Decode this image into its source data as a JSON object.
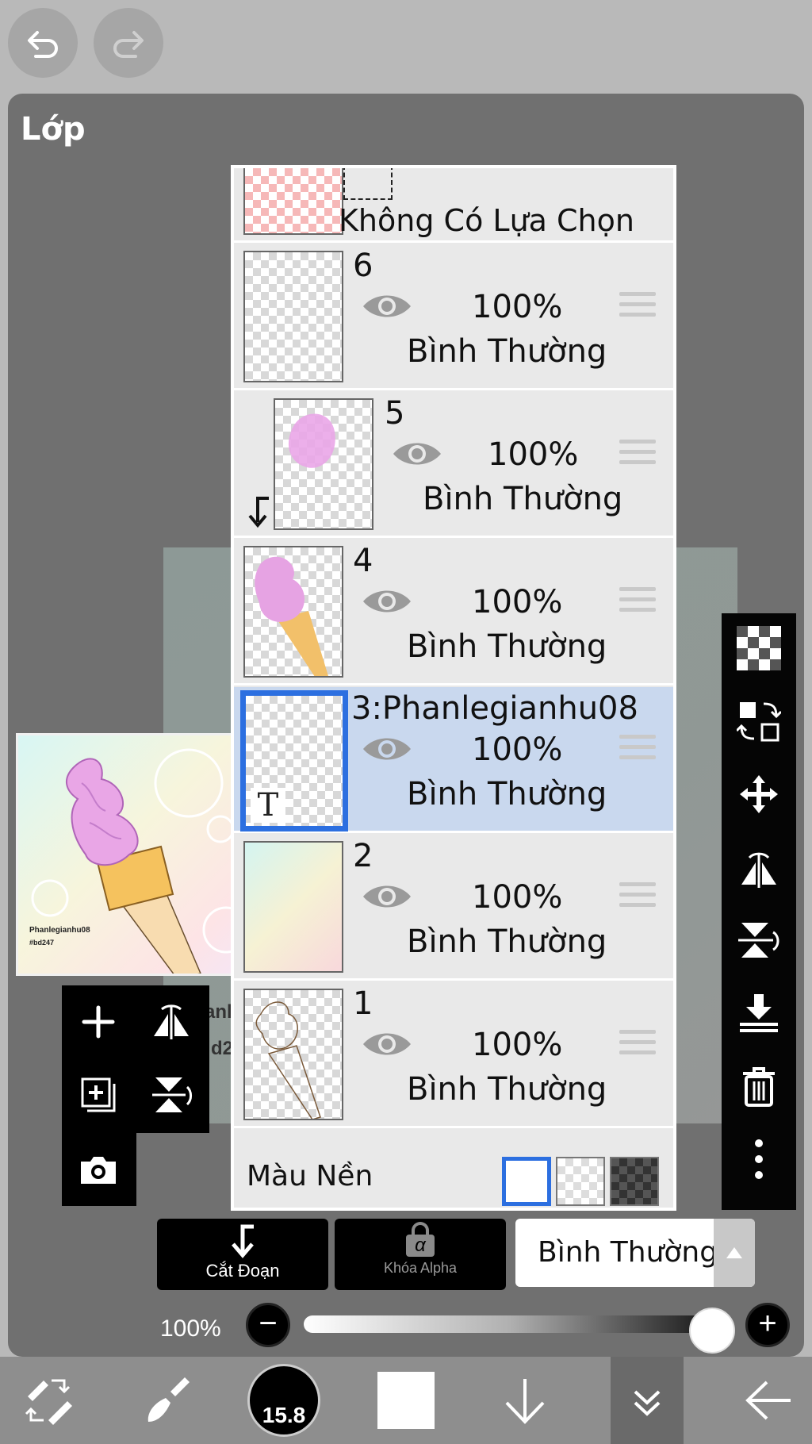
{
  "panel": {
    "title": "Lớp"
  },
  "layers": [
    {
      "name": "Không Có Lựa Chọn",
      "kind": "selection"
    },
    {
      "name": "6",
      "opacity": "100%",
      "blend": "Bình Thường"
    },
    {
      "name": "5",
      "opacity": "100%",
      "blend": "Bình Thường",
      "clipped": true
    },
    {
      "name": "4",
      "opacity": "100%",
      "blend": "Bình Thường"
    },
    {
      "name": "3:Phanlegianhu08",
      "opacity": "100%",
      "blend": "Bình Thường",
      "selected": true,
      "text_layer": true,
      "thumb_glyph": "T"
    },
    {
      "name": "2",
      "opacity": "100%",
      "blend": "Bình Thường"
    },
    {
      "name": "1",
      "opacity": "100%",
      "blend": "Bình Thường"
    }
  ],
  "background": {
    "label": "Màu Nền",
    "options": [
      "white",
      "transparent",
      "dark-checker"
    ],
    "selected": "white"
  },
  "preview": {
    "line1": "Phanlegianhu08",
    "line2": "#bd247"
  },
  "canvas_peek": {
    "line1": "anleg",
    "line2": "d247"
  },
  "actions": {
    "clip_label": "Cắt Đoạn",
    "alpha_lock_label": "Khóa Alpha",
    "alpha_glyph": "α"
  },
  "blend_mode": {
    "value": "Bình Thường"
  },
  "opacity": {
    "label": "100%",
    "value": 1.0,
    "minus": "−",
    "plus": "+"
  },
  "brush": {
    "size": "15.8"
  },
  "colors": {
    "accent": "#2c6fe0",
    "selected_row": "#c9d8ee",
    "panel": "#707070"
  }
}
